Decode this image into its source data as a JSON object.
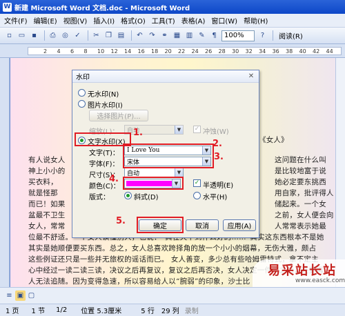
{
  "window": {
    "title": "新建 Microsoft Word 文档.doc - Microsoft Word",
    "icon": "word-icon"
  },
  "menu": [
    "文件(F)",
    "编辑(E)",
    "视图(V)",
    "插入(I)",
    "格式(O)",
    "工具(T)",
    "表格(A)",
    "窗口(W)",
    "帮助(H)"
  ],
  "toolbar": {
    "zoom": "100%",
    "read": "阅读(R)"
  },
  "ruler": [
    "2",
    "4",
    "6",
    "8",
    "10",
    "12",
    "14",
    "16",
    "18",
    "20",
    "22",
    "24",
    "26",
    "28",
    "30",
    "32",
    "34",
    "36",
    "38",
    "40",
    "42",
    "44"
  ],
  "doc": {
    "lines": [
      "《女人》",
      "有人说女人",
      "神上小小的",
      "买衣料，",
      "就是怪那",
      "而已！如果",
      "盆最不卫生",
      "女人，常常",
      "位最不舒适。一个女人读懂别人，也说：“真在天下到什么好的……”其实这东西根本不是她",
      "其实是她顺便要买东西。总之，女人总喜欢跨择角的放一个小小的烟幕，无伤大雅，颇占",
      "这些例证还只是一些并无旅权的谣话而已。   女人善变，多少总有些哈姆雷特式，拿不定主",
      "心中经过一读二读三读，决议之后再复议，复议之后再否决，女人决定一件事之后，还要再",
      "人无法追随。因为变得急速，所以容易给人以“腕弱”的印象，沙士比",
      "这问题在什么叫",
      "是比较地富于说",
      "她必定要东挑西",
      "用自家，批评得人",
      "储起来。一个女",
      "之前，女人便会向",
      "人常常表示她最"
    ]
  },
  "dialog": {
    "title": "水印",
    "no_wm": "无水印(N)",
    "pic_wm": "图片水印(I)",
    "select_pic": "选择图片(P)...",
    "scale_label": "缩放(L)：",
    "scale_value": "自动",
    "washout": "冲蚀(W)",
    "text_wm": "文字水印(X)",
    "text_label": "文字(T)：",
    "text_value": "I Love You",
    "font_label": "字体(F)：",
    "font_value": "宋体",
    "size_label": "尺寸(S)：",
    "size_value": "自动",
    "color_label": "颜色(C)：",
    "color_value": "#ff00ff",
    "semi": "半透明(E)",
    "layout_label": "版式：",
    "diag": "斜式(D)",
    "horiz": "水平(H)",
    "ok": "确定",
    "cancel": "取消",
    "apply": "应用(A)"
  },
  "annotations": [
    "1.",
    "2.",
    "3.",
    "4.",
    "5."
  ],
  "status": {
    "page": "1 页",
    "section": "1 节",
    "pages": "1/2",
    "pos": "位置 5.3厘米",
    "line": "5 行",
    "col": "29 列",
    "rec": "录制"
  },
  "watermark": {
    "main": "易采站长站",
    "sub": "www.easck.com"
  }
}
